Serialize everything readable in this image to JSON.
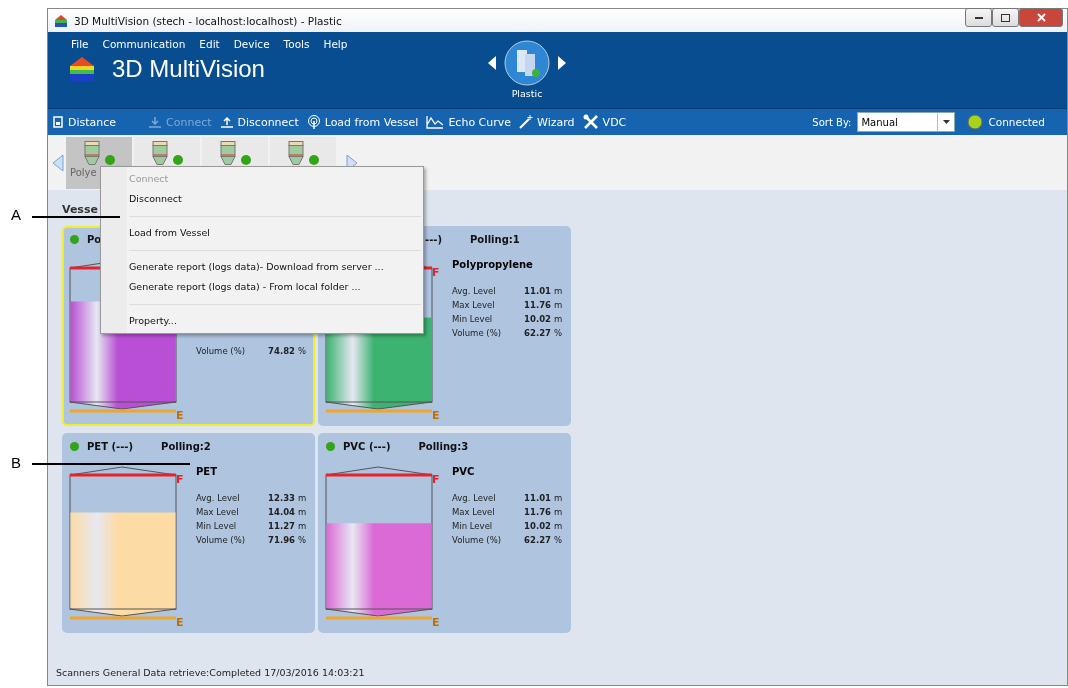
{
  "window": {
    "title": "3D MultiVision (stech - localhost:localhost) - Plastic"
  },
  "menu_bar": [
    "File",
    "Communication",
    "Edit",
    "Device",
    "Tools",
    "Help"
  ],
  "app_title": "3D MultiVision",
  "current_group": {
    "label": "Plastic"
  },
  "toolbar": [
    {
      "label": "Distance",
      "disabled": false
    },
    {
      "label": "Connect",
      "disabled": true
    },
    {
      "label": "Disconnect",
      "disabled": false
    },
    {
      "label": "Load from Vessel",
      "disabled": false
    },
    {
      "label": "Echo Curve",
      "disabled": false
    },
    {
      "label": "Wizard",
      "disabled": false
    },
    {
      "label": "VDC",
      "disabled": false
    }
  ],
  "sort_by": {
    "label": "Sort By:",
    "value": "Manual"
  },
  "connection": {
    "label": "Connected"
  },
  "devices": [
    {
      "label": "Polye",
      "selected": true
    },
    {
      "selected": false
    },
    {
      "selected": false
    },
    {
      "selected": false
    }
  ],
  "section_title": "Vesse",
  "vessels": [
    {
      "title": "Po",
      "selected": true,
      "level": 0.75,
      "color": "#b94fd4",
      "empty_mark": "E",
      "stats": [
        {
          "label": "Volume (%)",
          "value": "74.82",
          "unit": "%"
        }
      ]
    },
    {
      "title": "---)",
      "polling": "Polling:1",
      "name": "Polypropylene",
      "selected": false,
      "level": 0.63,
      "color": "#3cb371",
      "full_mark": "F",
      "empty_mark": "E",
      "stats": [
        {
          "label": "Avg. Level",
          "value": "11.01",
          "unit": "m"
        },
        {
          "label": "Max Level",
          "value": "11.76",
          "unit": "m"
        },
        {
          "label": "Min Level",
          "value": "10.02",
          "unit": "m"
        },
        {
          "label": "Volume (%)",
          "value": "62.27",
          "unit": "%"
        }
      ]
    },
    {
      "title": "PET (---)",
      "polling": "Polling:2",
      "name": "PET",
      "selected": false,
      "level": 0.72,
      "color": "#fddba4",
      "full_mark": "F",
      "empty_mark": "E",
      "stats": [
        {
          "label": "Avg. Level",
          "value": "12.33",
          "unit": "m"
        },
        {
          "label": "Max Level",
          "value": "14.04",
          "unit": "m"
        },
        {
          "label": "Min Level",
          "value": "11.27",
          "unit": "m"
        },
        {
          "label": "Volume (%)",
          "value": "71.96",
          "unit": "%"
        }
      ]
    },
    {
      "title": "PVC (---)",
      "polling": "Polling:3",
      "name": "PVC",
      "selected": false,
      "level": 0.64,
      "color": "#dc6ad6",
      "full_mark": "F",
      "empty_mark": "E",
      "stats": [
        {
          "label": "Avg. Level",
          "value": "11.01",
          "unit": "m"
        },
        {
          "label": "Max Level",
          "value": "11.76",
          "unit": "m"
        },
        {
          "label": "Min Level",
          "value": "10.02",
          "unit": "m"
        },
        {
          "label": "Volume (%)",
          "value": "62.27",
          "unit": "%"
        }
      ]
    }
  ],
  "context_menu": [
    {
      "kind": "item",
      "label": "Connect",
      "disabled": true
    },
    {
      "kind": "item",
      "label": "Disconnect",
      "disabled": false
    },
    {
      "kind": "separator"
    },
    {
      "kind": "item",
      "label": "Load from Vessel",
      "disabled": false
    },
    {
      "kind": "separator"
    },
    {
      "kind": "item",
      "label": "Generate report (logs data)- Download from server ...",
      "disabled": false
    },
    {
      "kind": "item",
      "label": "Generate report (logs data) - From local folder ...",
      "disabled": false
    },
    {
      "kind": "separator"
    },
    {
      "kind": "item",
      "label": "Property...",
      "disabled": false
    }
  ],
  "status_bar": "Scanners General Data retrieve:Completed 17/03/2016 14:03:21",
  "callouts": [
    {
      "label": "A"
    },
    {
      "label": "B"
    }
  ]
}
